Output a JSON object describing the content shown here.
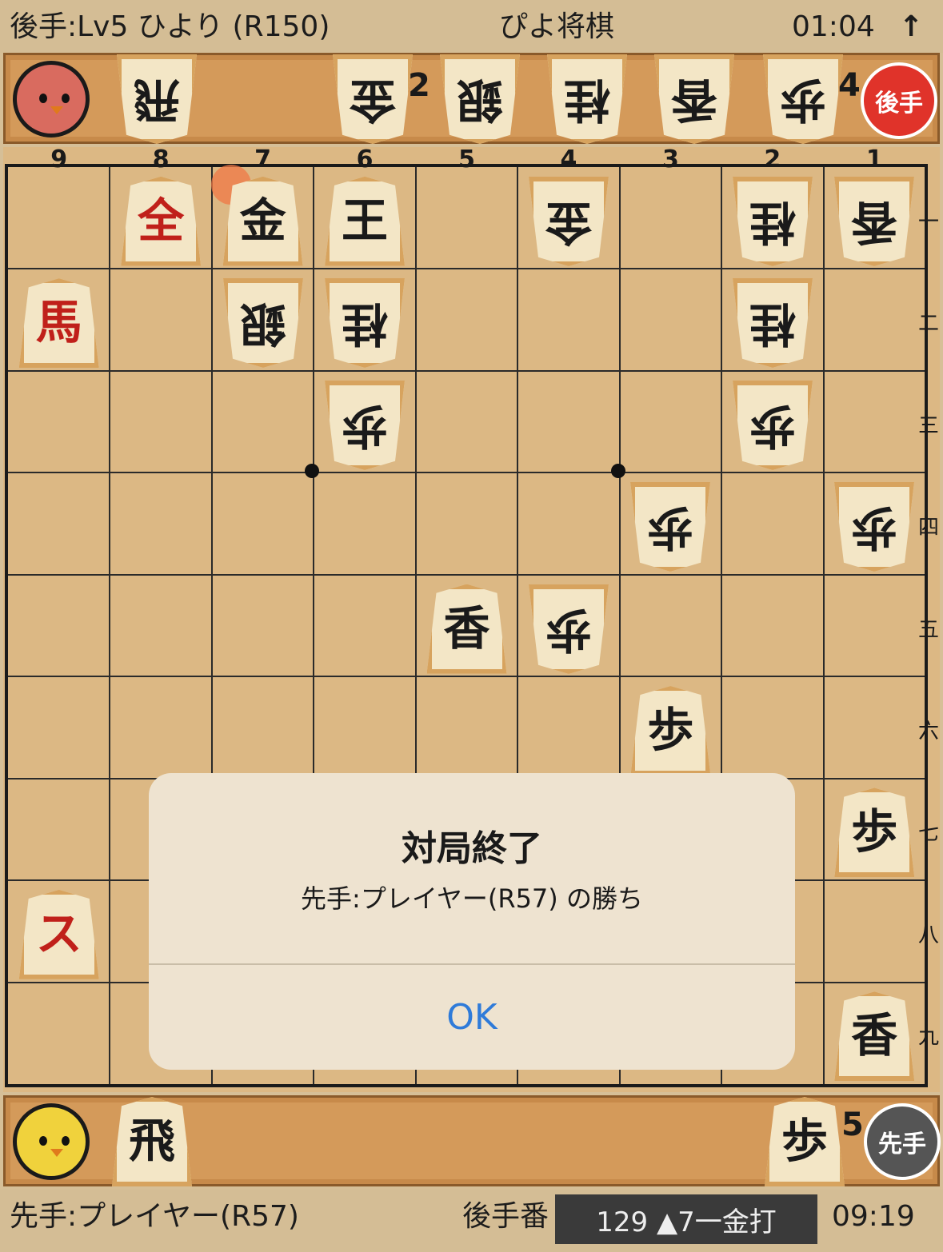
{
  "top": {
    "gote_player": "後手:Lv5 ひより (R150)",
    "app_title": "ぴよ将棋",
    "gote_time": "01:04",
    "arrow": "↑"
  },
  "gote_hand": {
    "badge": "後手",
    "pieces": [
      {
        "label": "飛",
        "count": ""
      },
      {
        "label": "金",
        "count": "2"
      },
      {
        "label": "銀",
        "count": ""
      },
      {
        "label": "桂",
        "count": ""
      },
      {
        "label": "香",
        "count": ""
      },
      {
        "label": "歩",
        "count": "4"
      }
    ]
  },
  "board": {
    "col_labels": [
      "9",
      "8",
      "7",
      "6",
      "5",
      "4",
      "3",
      "2",
      "1"
    ],
    "row_labels": [
      "一",
      "二",
      "三",
      "四",
      "五",
      "六",
      "七",
      "八",
      "九"
    ],
    "pieces": [
      {
        "label": "全",
        "side": "sente",
        "promoted": true,
        "col": 8,
        "row": 1
      },
      {
        "label": "金",
        "side": "sente",
        "promoted": false,
        "col": 7,
        "row": 1
      },
      {
        "label": "王",
        "side": "sente",
        "promoted": false,
        "col": 6,
        "row": 1
      },
      {
        "label": "金",
        "side": "gote",
        "promoted": false,
        "col": 4,
        "row": 1
      },
      {
        "label": "桂",
        "side": "gote",
        "promoted": false,
        "col": 2,
        "row": 1
      },
      {
        "label": "香",
        "side": "gote",
        "promoted": false,
        "col": 1,
        "row": 1
      },
      {
        "label": "馬",
        "side": "sente",
        "promoted": true,
        "col": 9,
        "row": 2
      },
      {
        "label": "銀",
        "side": "gote",
        "promoted": false,
        "col": 7,
        "row": 2
      },
      {
        "label": "桂",
        "side": "gote",
        "promoted": false,
        "col": 6,
        "row": 2
      },
      {
        "label": "桂",
        "side": "gote",
        "promoted": false,
        "col": 2,
        "row": 2
      },
      {
        "label": "歩",
        "side": "gote",
        "promoted": false,
        "col": 6,
        "row": 3
      },
      {
        "label": "歩",
        "side": "gote",
        "promoted": false,
        "col": 2,
        "row": 3
      },
      {
        "label": "歩",
        "side": "gote",
        "promoted": false,
        "col": 3,
        "row": 4
      },
      {
        "label": "歩",
        "side": "gote",
        "promoted": false,
        "col": 1,
        "row": 4
      },
      {
        "label": "香",
        "side": "sente",
        "promoted": false,
        "col": 5,
        "row": 5
      },
      {
        "label": "歩",
        "side": "gote",
        "promoted": false,
        "col": 4,
        "row": 5
      },
      {
        "label": "歩",
        "side": "sente",
        "promoted": false,
        "col": 3,
        "row": 6
      },
      {
        "label": "歩",
        "side": "sente",
        "promoted": false,
        "col": 1,
        "row": 7
      },
      {
        "label": "ス",
        "side": "sente",
        "promoted": true,
        "col": 9,
        "row": 8
      },
      {
        "label": "香",
        "side": "sente",
        "promoted": false,
        "col": 1,
        "row": 9
      }
    ]
  },
  "sente_hand": {
    "badge": "先手",
    "pieces": [
      {
        "label": "飛",
        "count": ""
      },
      {
        "label": "歩",
        "count": "5"
      }
    ]
  },
  "dialog": {
    "title": "対局終了",
    "message": "先手:プレイヤー(R57) の勝ち",
    "ok_label": "OK"
  },
  "bottom": {
    "sente_player": "先手:プレイヤー(R57)",
    "turn": "後手番",
    "move": "129 ▲7一金打",
    "sente_time": "09:19"
  },
  "colors": {
    "gote_badge": "#e0332a",
    "sente_badge": "#555555",
    "gote_avatar": "#d96b5f",
    "sente_avatar": "#f0d23c",
    "ok_text": "#2f7bd9"
  }
}
